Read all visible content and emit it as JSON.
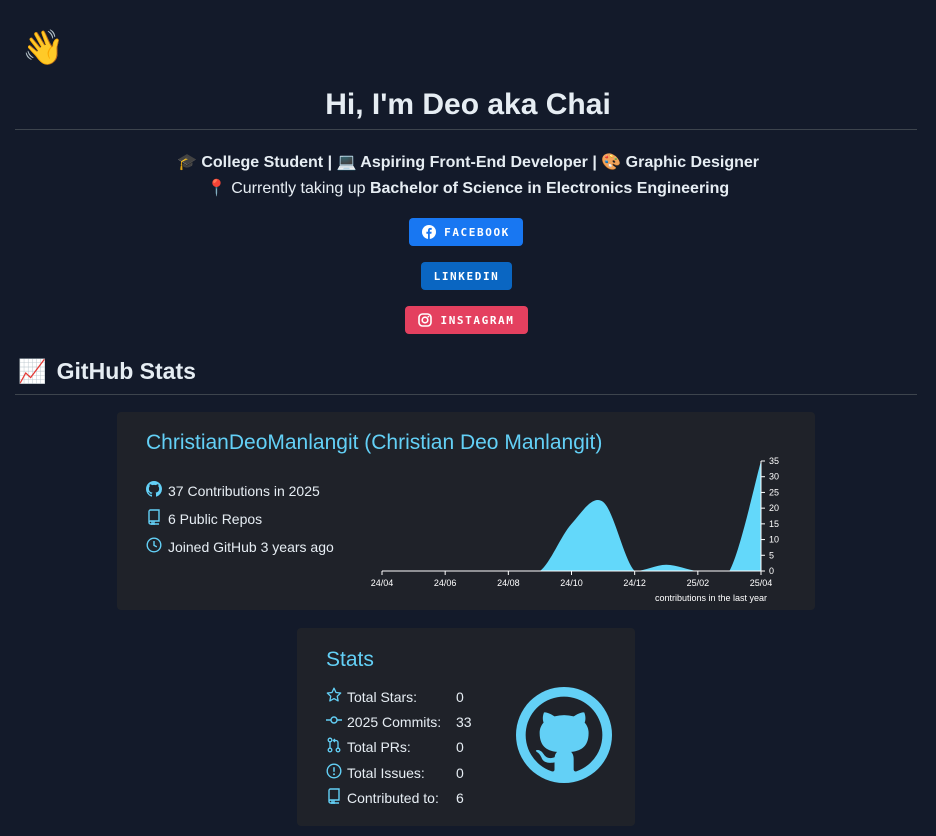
{
  "hero": {
    "wave_emoji": "👋",
    "title": "Hi, I'm Deo aka Chai",
    "roles": [
      {
        "emoji": "🎓",
        "text": "College Student"
      },
      {
        "emoji": "💻",
        "text": "Aspiring Front-End Developer"
      },
      {
        "emoji": "🎨",
        "text": "Graphic Designer"
      }
    ],
    "separator": "|",
    "location_emoji": "📍",
    "currently_prefix": "Currently taking up",
    "degree": "Bachelor of Science in Electronics Engineering"
  },
  "badges": {
    "facebook": "FACEBOOK",
    "linkedin": "LINKEDIN",
    "instagram": "INSTAGRAM",
    "colors": {
      "facebook": "#1877f2",
      "linkedin": "#0a66c2",
      "instagram": "#e4405f"
    }
  },
  "section": {
    "emoji": "📈",
    "title": "GitHub Stats"
  },
  "profile_card": {
    "name": "ChristianDeoManlangit (Christian Deo Manlangit)",
    "contributions": "37 Contributions in 2025",
    "repos": "6 Public Repos",
    "joined": "Joined GitHub 3 years ago",
    "icons": [
      "github-icon",
      "repo-icon",
      "clock-icon"
    ]
  },
  "chart_data": {
    "type": "area",
    "x": [
      "24/04",
      "24/06",
      "24/08",
      "24/10",
      "24/12",
      "25/02",
      "25/04"
    ],
    "xlabel": "contributions in the last year",
    "ylabel": "",
    "ylim": [
      0,
      35
    ],
    "yticks": [
      0,
      5,
      10,
      15,
      20,
      25,
      30,
      35
    ],
    "series": [
      {
        "values": [
          {
            "x": "24/04",
            "y": 0
          },
          {
            "x": "24/05",
            "y": 0
          },
          {
            "x": "24/06",
            "y": 0
          },
          {
            "x": "24/07",
            "y": 0
          },
          {
            "x": "24/08",
            "y": 0
          },
          {
            "x": "24/09",
            "y": 0
          },
          {
            "x": "24/10",
            "y": 15
          },
          {
            "x": "24/11",
            "y": 22
          },
          {
            "x": "24/12",
            "y": 0
          },
          {
            "x": "25/01",
            "y": 2
          },
          {
            "x": "25/02",
            "y": 0
          },
          {
            "x": "25/03",
            "y": 0
          },
          {
            "x": "25/04",
            "y": 35
          }
        ]
      }
    ],
    "color": "#63d8fa"
  },
  "stats_card": {
    "title": "Stats",
    "rows": [
      {
        "icon": "star-icon",
        "label": "Total Stars:",
        "value": "0"
      },
      {
        "icon": "commit-icon",
        "label": "2025 Commits:",
        "value": "33"
      },
      {
        "icon": "pull-request-icon",
        "label": "Total PRs:",
        "value": "0"
      },
      {
        "icon": "issue-icon",
        "label": "Total Issues:",
        "value": "0"
      },
      {
        "icon": "repo-icon",
        "label": "Contributed to:",
        "value": "6"
      }
    ],
    "accent": "#63d0f6"
  }
}
